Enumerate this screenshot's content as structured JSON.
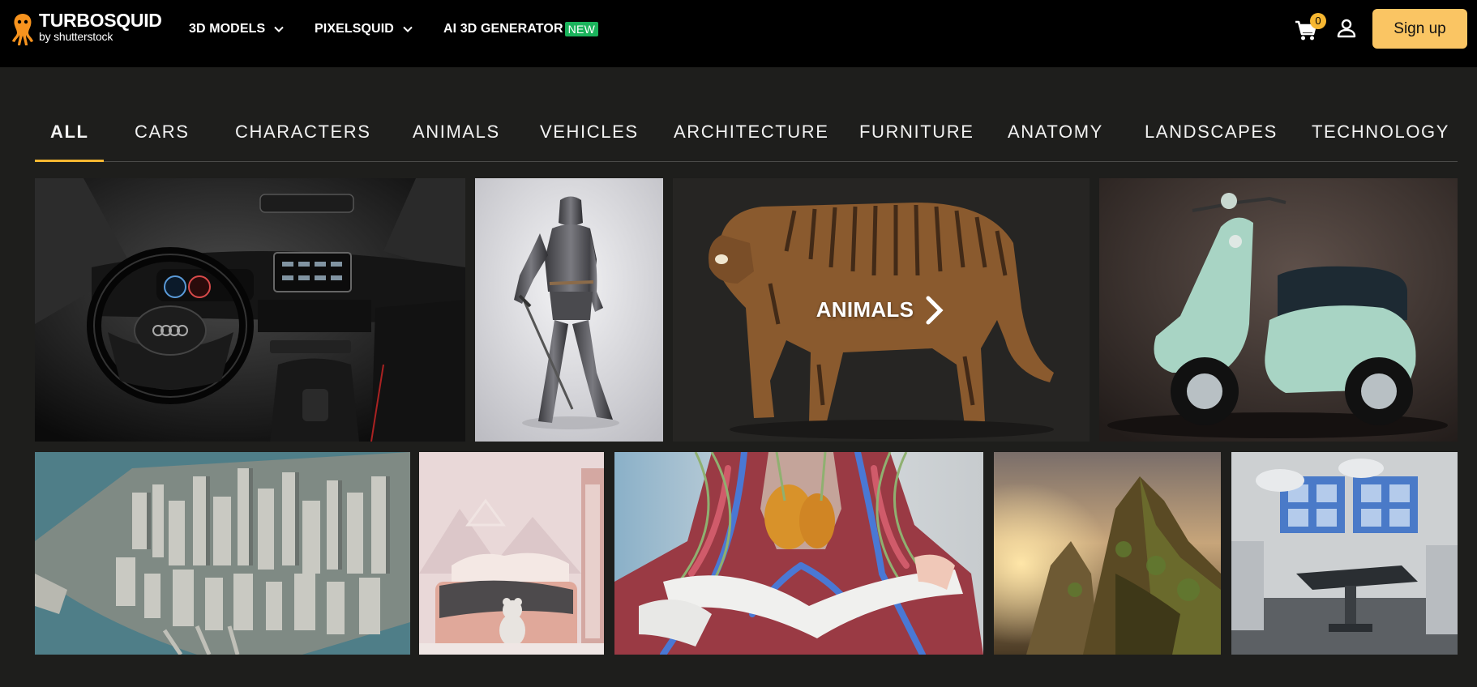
{
  "brand": {
    "name": "TURBOSQUID",
    "byline": "by shutterstock"
  },
  "nav": {
    "items": [
      {
        "label": "3D MODELS",
        "has_dropdown": true
      },
      {
        "label": "PIXELSQUID",
        "has_dropdown": true
      },
      {
        "label": "AI 3D GENERATOR",
        "has_dropdown": false
      }
    ],
    "new_badge": "NEW"
  },
  "header": {
    "cart_count": "0",
    "signup_label": "Sign up",
    "accent_color": "#fac563"
  },
  "tabs": [
    {
      "label": "ALL",
      "active": true
    },
    {
      "label": "CARS"
    },
    {
      "label": "CHARACTERS"
    },
    {
      "label": "ANIMALS"
    },
    {
      "label": "VEHICLES"
    },
    {
      "label": "ARCHITECTURE"
    },
    {
      "label": "FURNITURE"
    },
    {
      "label": "ANATOMY"
    },
    {
      "label": "LANDSCAPES"
    },
    {
      "label": "TECHNOLOGY"
    }
  ],
  "tiles": [
    {
      "name": "car-interior-image",
      "icon": "car-dashboard"
    },
    {
      "name": "knight-armor-image",
      "icon": "knight"
    },
    {
      "name": "tiger-image",
      "icon": "tiger",
      "overlay": "ANIMALS"
    },
    {
      "name": "scooter-image",
      "icon": "vespa-scooter"
    },
    {
      "name": "city-aerial-image",
      "icon": "city"
    },
    {
      "name": "kids-bedroom-image",
      "icon": "bedroom"
    },
    {
      "name": "anatomy-neck-image",
      "icon": "anatomy"
    },
    {
      "name": "mountain-landscape-image",
      "icon": "landscape"
    },
    {
      "name": "operating-room-image",
      "icon": "hospital-room"
    }
  ]
}
